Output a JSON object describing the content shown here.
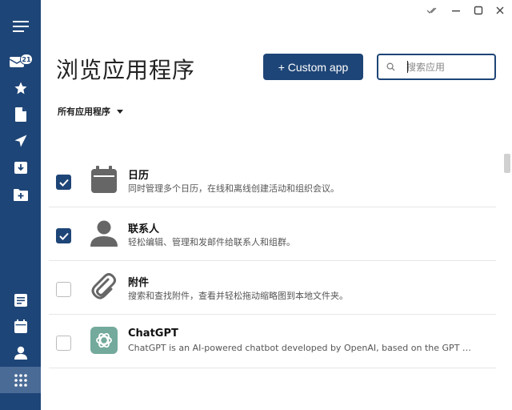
{
  "header": {
    "title": "浏览应用程序",
    "custom_app_label": "+ Custom app",
    "search_placeholder": "搜索应用",
    "filter_label": "所有应用程序"
  },
  "sidebar": {
    "mail_badge": "21",
    "items": [
      {
        "icon": "menu-icon"
      },
      {
        "icon": "mail-icon"
      },
      {
        "icon": "star-icon"
      },
      {
        "icon": "document-icon"
      },
      {
        "icon": "send-icon"
      },
      {
        "icon": "archive-icon"
      },
      {
        "icon": "folder-add-icon"
      },
      {
        "icon": "notes-icon"
      },
      {
        "icon": "calendar-icon"
      },
      {
        "icon": "contacts-icon"
      },
      {
        "icon": "apps-icon",
        "active": true
      }
    ]
  },
  "apps": [
    {
      "name": "日历",
      "description": "同时管理多个日历，在线和离线创建活动和组织会议。",
      "checked": true,
      "icon": "calendar-icon"
    },
    {
      "name": "联系人",
      "description": "轻松编辑、管理和发邮件给联系人和组群。",
      "checked": true,
      "icon": "person-icon"
    },
    {
      "name": "附件",
      "description": "搜索和查找附件，查看并轻松拖动缩略图到本地文件夹。",
      "checked": false,
      "icon": "paperclip-icon"
    },
    {
      "name": "ChatGPT",
      "description": "ChatGPT is an AI-powered chatbot developed by OpenAI, based on the GPT language model.",
      "checked": false,
      "icon": "openai-icon"
    }
  ],
  "colors": {
    "primary": "#1e4577",
    "sidebar_active": "#4a6b96",
    "chatgpt": "#74aa9c"
  }
}
